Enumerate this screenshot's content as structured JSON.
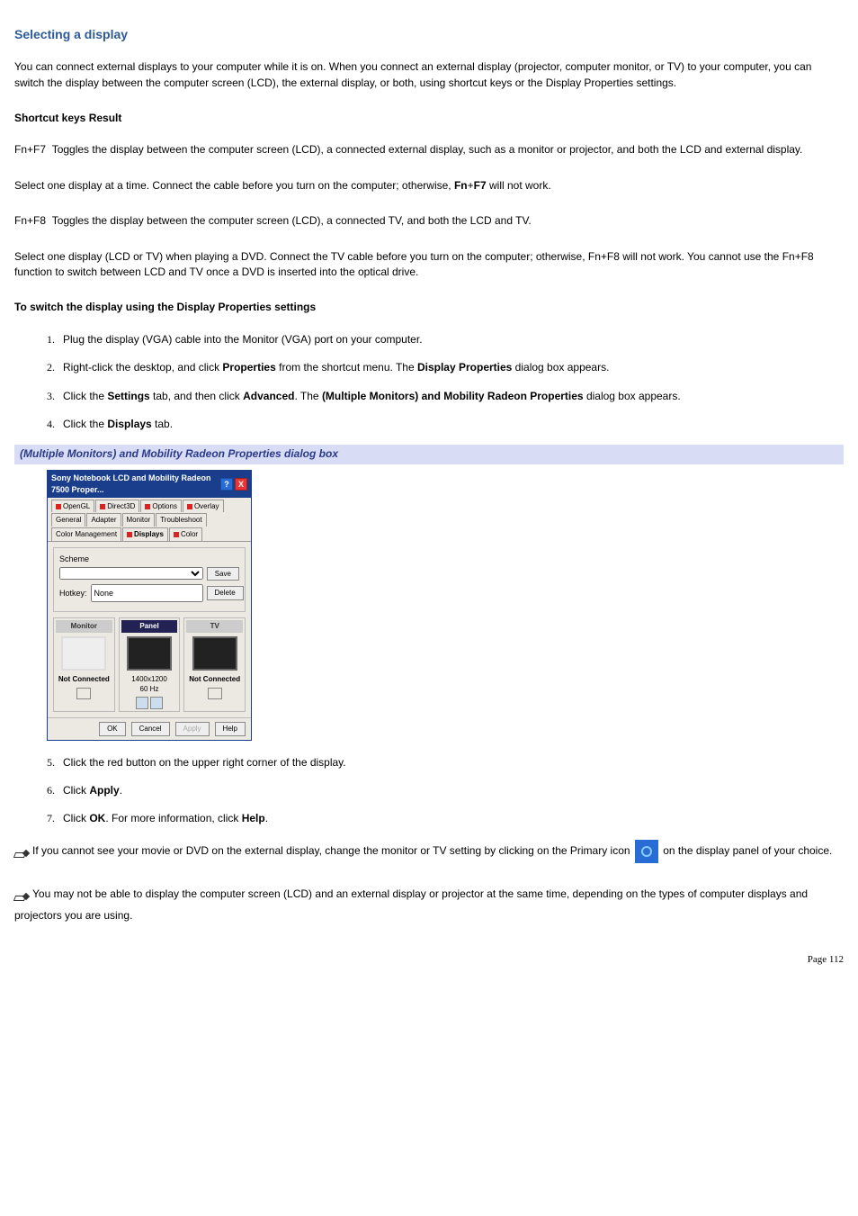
{
  "title": "Selecting a display",
  "intro": "You can connect external displays to your computer while it is on. When you connect an external display (projector, computer monitor, or TV) to your computer, you can switch the display between the computer screen (LCD), the external display, or both, using shortcut keys or the Display Properties settings.",
  "shortcut_header": "Shortcut keys Result",
  "fn_f7_label": "Fn+F7",
  "fn_f7_desc": "Toggles the display between the computer screen (LCD), a connected external display, such as a monitor or projector, and both the LCD and external display.",
  "fn_f7_note_pre": "Select one display at a time. Connect the cable before you turn on the computer; otherwise, ",
  "fn_f7_note_b1": "Fn",
  "fn_f7_note_plus": "+",
  "fn_f7_note_b2": "F7",
  "fn_f7_note_post": " will not work.",
  "fn_f8_label": "Fn+F8",
  "fn_f8_desc": "Toggles the display between the computer screen (LCD), a connected TV, and both the LCD and TV.",
  "fn_f8_note": "Select one display (LCD or TV) when playing a DVD. Connect the TV cable before you turn on the computer; otherwise, Fn+F8 will not work. You cannot use the Fn+F8 function to switch between LCD and TV once a DVD is inserted into the optical drive.",
  "procedure_head": "To switch the display using the Display Properties settings",
  "steps1": {
    "s1": "Plug the display (VGA) cable into the Monitor (VGA) port on your computer.",
    "s2_pre": "Right-click the desktop, and click ",
    "s2_b1": "Properties",
    "s2_mid": " from the shortcut menu. The ",
    "s2_b2": "Display Properties",
    "s2_post": " dialog box appears.",
    "s3_pre": "Click the ",
    "s3_b1": "Settings",
    "s3_mid1": " tab, and then click ",
    "s3_b2": "Advanced",
    "s3_mid2": ". The ",
    "s3_b3": "(Multiple Monitors) and Mobility Radeon Properties",
    "s3_post": " dialog box appears.",
    "s4_pre": "Click the ",
    "s4_b1": "Displays",
    "s4_post": " tab."
  },
  "caption": "(Multiple Monitors) and Mobility Radeon Properties dialog box",
  "dialog": {
    "title": "Sony Notebook LCD and Mobility Radeon 7500 Proper...",
    "tabs_row1": [
      "OpenGL",
      "Direct3D",
      "Options",
      "Overlay"
    ],
    "tabs_row2": [
      "General",
      "Adapter",
      "",
      "Monitor"
    ],
    "tabs_row3": [
      "Troubleshoot",
      "Color Management",
      "Displays",
      "Color"
    ],
    "scheme_label": "Scheme",
    "hotkey_label": "Hotkey:",
    "hotkey_value": "None",
    "btn_save": "Save",
    "btn_delete": "Delete",
    "col1_head": "Monitor",
    "col2_head": "Panel",
    "col3_head": "TV",
    "col1_status": "Not Connected",
    "col2_res": "1400x1200",
    "col2_hz": "60 Hz",
    "col3_status": "Not Connected",
    "btn_ok": "OK",
    "btn_cancel": "Cancel",
    "btn_apply": "Apply",
    "btn_help": "Help"
  },
  "steps2": {
    "s5": "Click the red button on the upper right corner of the display.",
    "s6_pre": "Click ",
    "s6_b": "Apply",
    "s6_post": ".",
    "s7_pre": "Click ",
    "s7_b1": "OK",
    "s7_mid": ". For more information, click ",
    "s7_b2": "Help",
    "s7_post": "."
  },
  "note1_pre": "If you cannot see your movie or DVD on the external display, change the monitor or TV setting by clicking on the Primary icon ",
  "note1_post": " on the display panel of your choice.",
  "note2": "You may not be able to display the computer screen (LCD) and an external display or projector at the same time, depending on the types of computer displays and projectors you are using.",
  "page": "Page 112"
}
